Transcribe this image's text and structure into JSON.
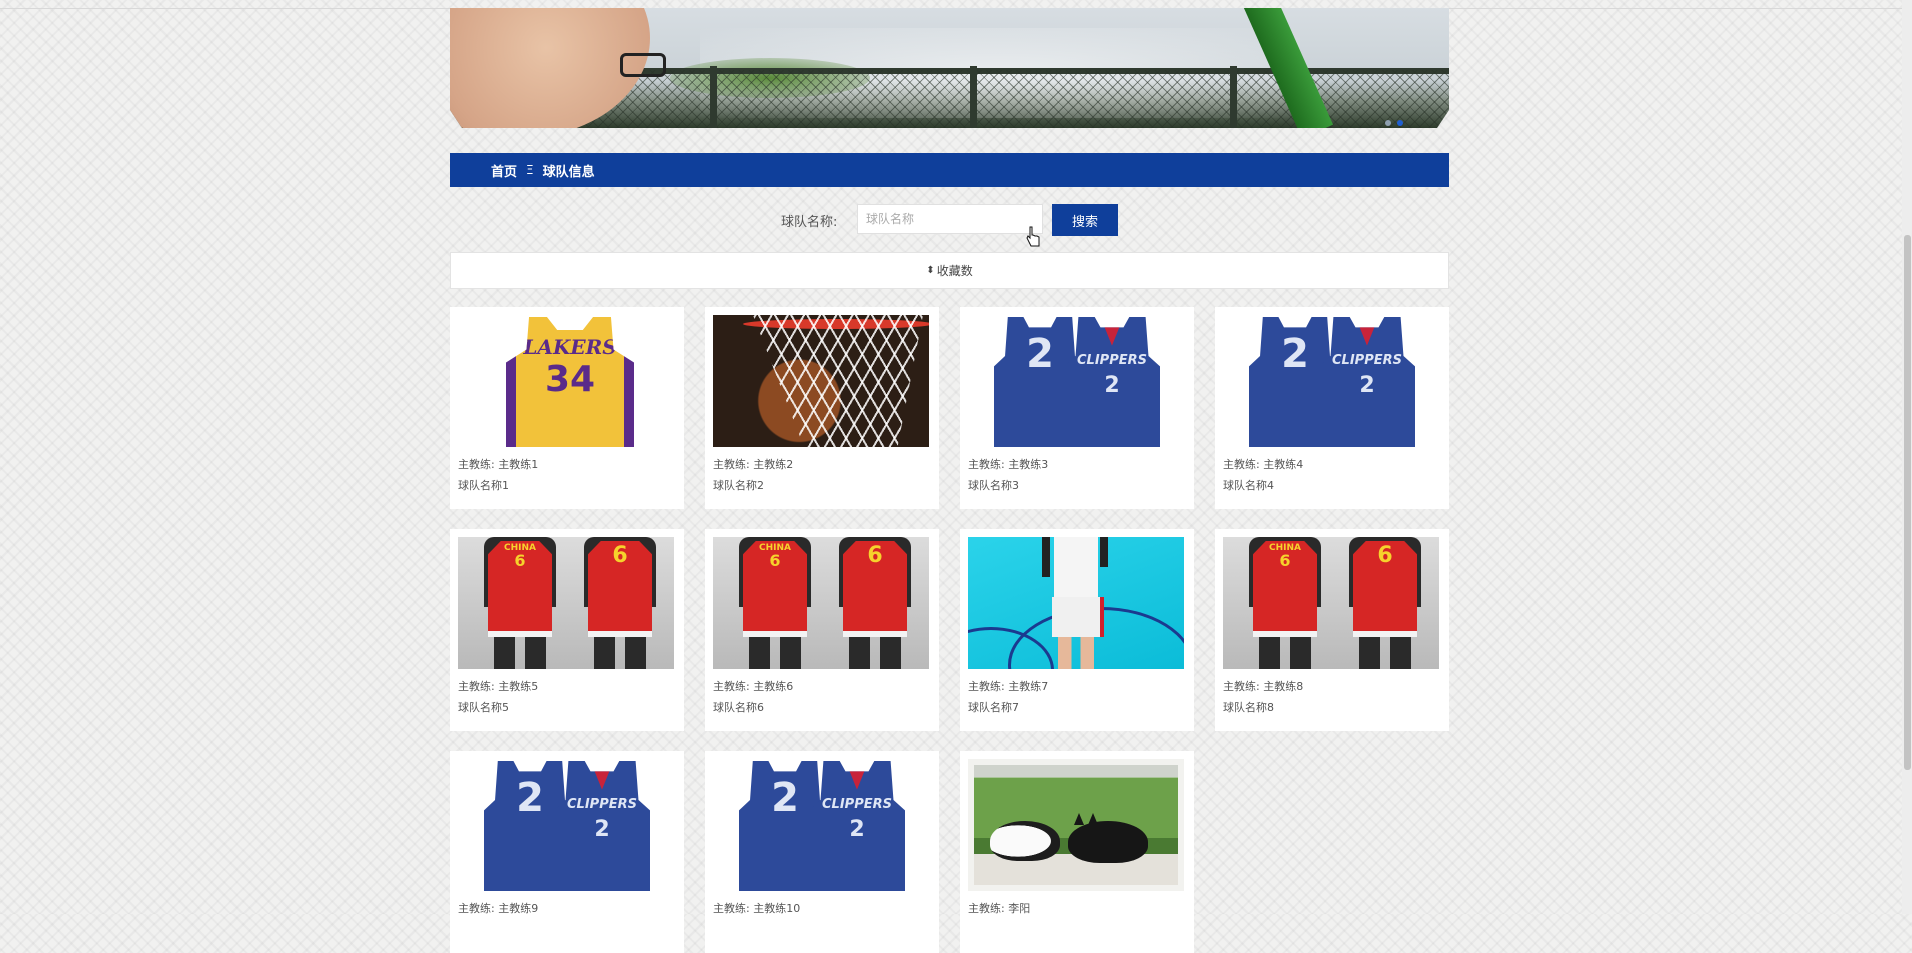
{
  "breadcrumb": {
    "home": "首页",
    "separator": "Ξ",
    "current": "球队信息"
  },
  "search": {
    "label": "球队名称:",
    "placeholder": "球队名称",
    "value": "",
    "button": "搜索"
  },
  "sort": {
    "icon": "sort-icon",
    "label": "收藏数"
  },
  "banner": {
    "dots": 2,
    "active_dot": 1
  },
  "cards": [
    {
      "coach": "主教练: 主教练1",
      "name": "球队名称1",
      "image": "lakers-jersey"
    },
    {
      "coach": "主教练: 主教练2",
      "name": "球队名称2",
      "image": "basketball-hoop"
    },
    {
      "coach": "主教练: 主教练3",
      "name": "球队名称3",
      "image": "clippers-jersey"
    },
    {
      "coach": "主教练: 主教练4",
      "name": "球队名称4",
      "image": "clippers-jersey"
    },
    {
      "coach": "主教练: 主教练5",
      "name": "球队名称5",
      "image": "china-jersey"
    },
    {
      "coach": "主教练: 主教练6",
      "name": "球队名称6",
      "image": "china-jersey"
    },
    {
      "coach": "主教练: 主教练7",
      "name": "球队名称7",
      "image": "court-player"
    },
    {
      "coach": "主教练: 主教练8",
      "name": "球队名称8",
      "image": "china-jersey"
    },
    {
      "coach": "主教练: 主教练9",
      "name": "",
      "image": "clippers-jersey"
    },
    {
      "coach": "主教练: 主教练10",
      "name": "",
      "image": "clippers-jersey"
    },
    {
      "coach": "主教练: 李阳",
      "name": "",
      "image": "cats-window"
    }
  ],
  "jersey_text": {
    "lakers": "LAKERS",
    "lakers_number": "34",
    "clippers": "CLIPPERS",
    "clippers_number": "2",
    "china": "CHINA",
    "china_number": "6"
  },
  "colors": {
    "brand_blue": "#0f3f9b",
    "lakers_gold": "#f2c23a",
    "lakers_purple": "#5a2b8a",
    "clippers_blue": "#2d4a9a",
    "china_red": "#d62625"
  }
}
